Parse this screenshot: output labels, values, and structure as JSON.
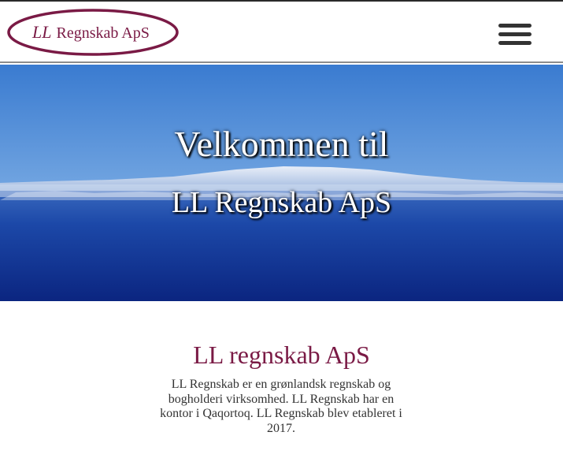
{
  "header": {
    "logo_initials": "LL",
    "logo_name": "Regnskab ApS",
    "menu_icon": "hamburger-menu-icon"
  },
  "hero": {
    "line1": "Velkommen til",
    "line2": "LL Regnskab ApS"
  },
  "intro": {
    "heading": "LL regnskab ApS",
    "body": "LL Regnskab er en grønlandsk regnskab og bogholderi virksomhed. LL Regnskab har en kontor i Qaqortoq. LL Regnskab blev etableret i 2017."
  },
  "colors": {
    "brand": "#7a1a45",
    "hero_sky": "#3a7bd0",
    "hero_sea": "#0e2d8a"
  }
}
